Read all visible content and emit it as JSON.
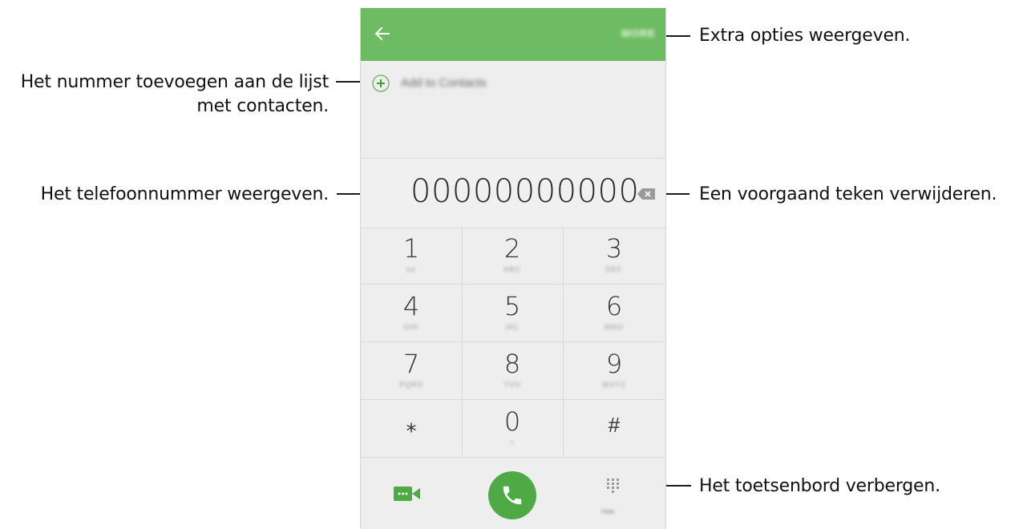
{
  "callouts": {
    "more_options": "Extra opties weergeven.",
    "add_contact_line1": "Het nummer toevoegen aan de lijst",
    "add_contact_line2": "met contacten.",
    "show_number": "Het telefoonnummer weergeven.",
    "delete_char": "Een voorgaand teken verwijderen.",
    "hide_keypad": "Het toetsenbord verbergen."
  },
  "appbar": {
    "back_icon": "arrow-left-icon",
    "more_label": "MORE",
    "color": "#6dbb63"
  },
  "add_to_contacts": {
    "icon": "plus-circle-icon",
    "label": "Add to Contacts"
  },
  "dialer": {
    "number": "00000000000",
    "backspace_icon": "backspace-icon"
  },
  "keypad": {
    "keys": [
      {
        "digit": "1",
        "letters": "oo"
      },
      {
        "digit": "2",
        "letters": "ABC"
      },
      {
        "digit": "3",
        "letters": "DEF"
      },
      {
        "digit": "4",
        "letters": "GHI"
      },
      {
        "digit": "5",
        "letters": "JKL"
      },
      {
        "digit": "6",
        "letters": "MNO"
      },
      {
        "digit": "7",
        "letters": "PQRS"
      },
      {
        "digit": "8",
        "letters": "TUV"
      },
      {
        "digit": "9",
        "letters": "WXYZ"
      },
      {
        "digit": "⁎",
        "letters": ""
      },
      {
        "digit": "0",
        "letters": "+"
      },
      {
        "digit": "#",
        "letters": ""
      }
    ]
  },
  "bottom": {
    "video_icon": "video-call-icon",
    "call_icon": "phone-call-icon",
    "keypad_toggle_icon": "keypad-icon",
    "keypad_toggle_label": "Hide",
    "call_color": "#4faa46"
  }
}
